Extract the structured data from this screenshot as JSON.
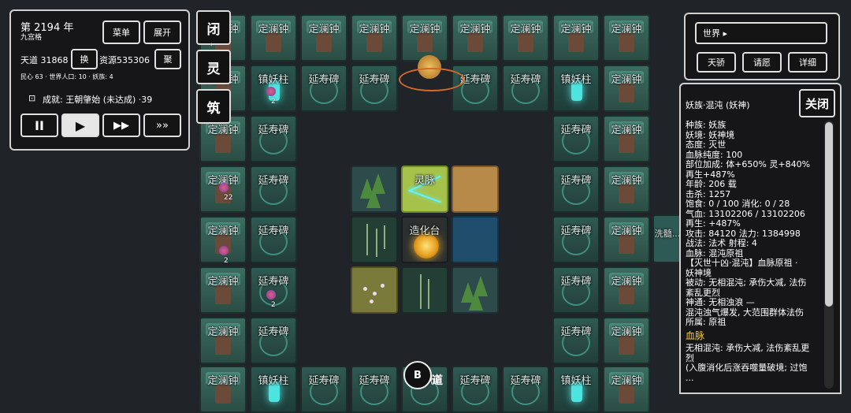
{
  "tiles": {
    "bell": "定澜钟",
    "stele": "延寿碑",
    "pillar": "镇妖柱",
    "vein": "灵脉",
    "core": "造化台",
    "stele_partial": "延寿碑",
    "side_partial": "洗髓..."
  },
  "counts": {
    "a": "2",
    "b": "22",
    "c": "2",
    "d": "2"
  },
  "top_panel": {
    "year": "第 2194 年",
    "formation": "九宫格",
    "menu": "菜单",
    "expand": "展开",
    "tiandao": "天道 31868",
    "swap": "换",
    "resources": "资源535306",
    "gather": "聚",
    "stats": "民心 63 · 世界人口: 10 · 妖族: 4",
    "achievement": "成就: 王朝肇始 (未达成) ·39",
    "speeds": {
      "pause": "II",
      "play": "▶",
      "fast": "▶▶",
      "faster": "»»"
    }
  },
  "side_buttons": {
    "close": "闭",
    "spirit": "灵",
    "build": "筑",
    "chevron": "‹"
  },
  "world_panel": {
    "world": "世界 ▸",
    "pride": "天骄",
    "wish": "请愿",
    "detail": "详细"
  },
  "info": {
    "title": "妖族·混沌 (妖神)",
    "close": "关闭",
    "lines": [
      "种族: 妖族",
      "妖境: 妖神境",
      "态度: 灭世",
      "血脉纯度: 100",
      "部位加成: 体+650% 灵+840%",
      "再生+487%",
      "年龄: 206 载",
      "击杀: 1257",
      "饱食: 0 / 100   消化: 0 / 28",
      "气血: 13102206 / 13102206",
      "再生: +487%",
      "攻击: 84120   法力: 1384998",
      "战法: 法术   射程: 4",
      "血脉: 混沌原祖",
      "【灭世十凶·混沌】血脉原祖 ·",
      "妖神境",
      "被动: 无相混沌; 承伤大减, 法伤",
      "紊乱更烈",
      "神通: 无相浊浪 —",
      "混沌浊气爆发, 大范围群体法伤",
      "所属: 原祖"
    ],
    "section": "血脉",
    "lines2": [
      "无相混沌: 承伤大减, 法伤紊乱更",
      "烈",
      "(入腹消化后涨吞噬量破境; 过饱",
      "..."
    ]
  },
  "bottom": {
    "label": "道",
    "icon": "B"
  }
}
